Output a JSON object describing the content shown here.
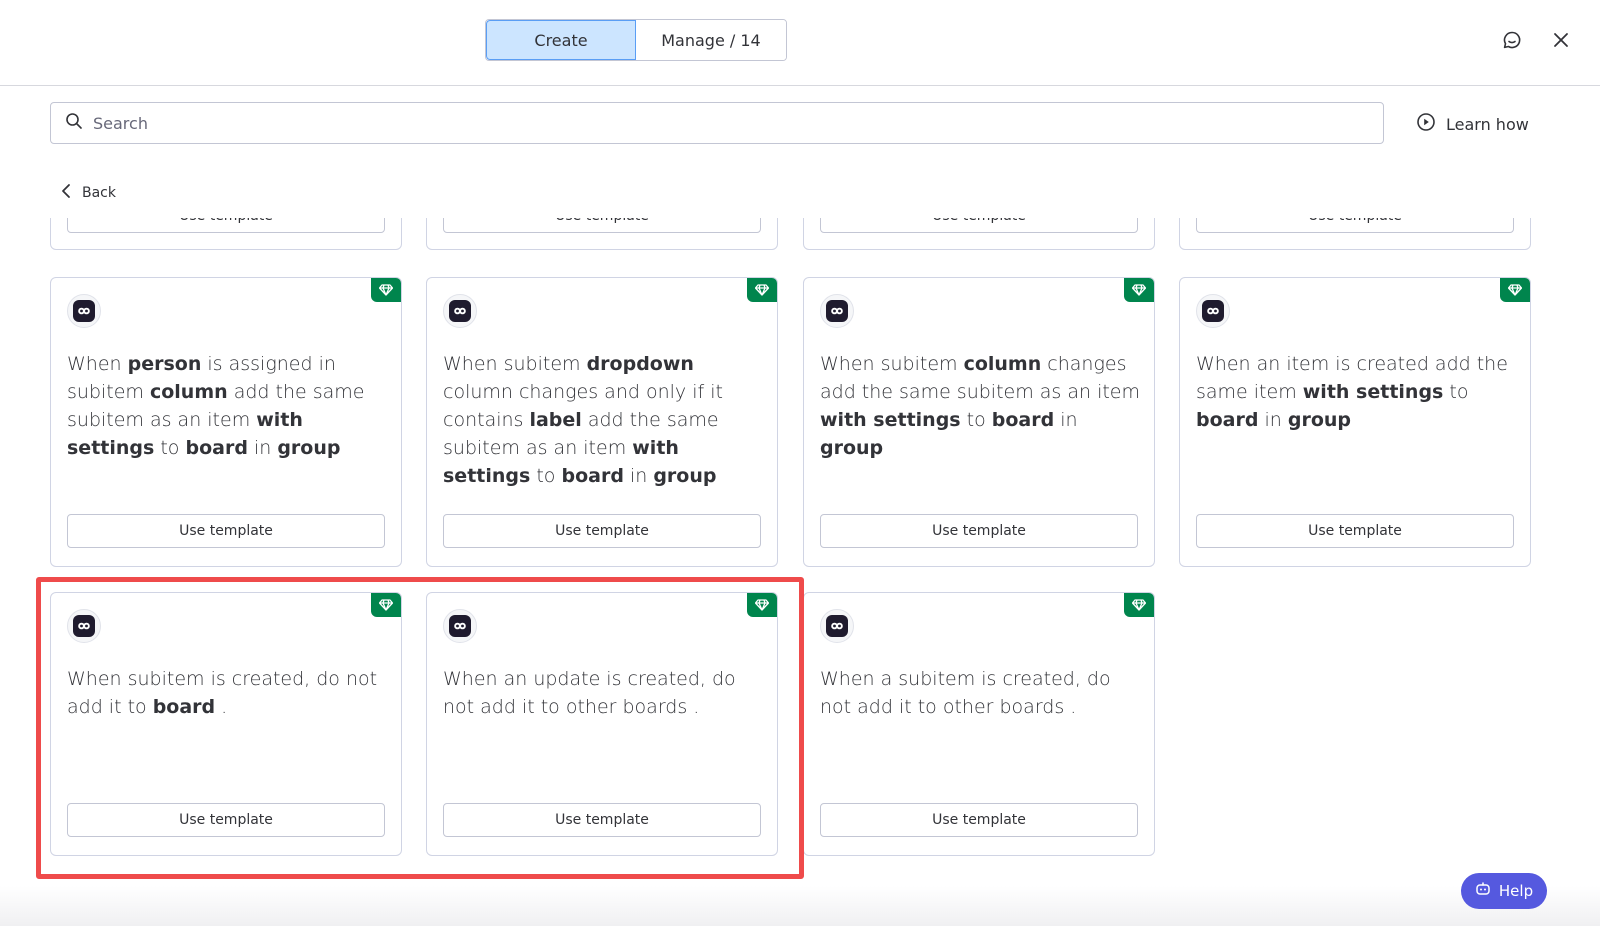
{
  "tabs": {
    "create": "Create",
    "manage": "Manage / 14"
  },
  "search": {
    "placeholder": "Search"
  },
  "learn_how": "Learn how",
  "back": "Back",
  "use_template": "Use template",
  "help": "Help",
  "colors": {
    "accent": "#cce5ff",
    "premium_badge": "#00854d",
    "highlight": "#ef4b4b",
    "help_button": "#5559df"
  },
  "cards": [
    {
      "parts": [
        [
          "When ",
          false
        ],
        [
          "person",
          true
        ],
        [
          " is assigned in subitem ",
          false
        ],
        [
          "column",
          true
        ],
        [
          " add the same subitem as an item ",
          false
        ],
        [
          "with settings",
          true
        ],
        [
          " to ",
          false
        ],
        [
          "board",
          true
        ],
        [
          " in ",
          false
        ],
        [
          "group",
          true
        ]
      ]
    },
    {
      "parts": [
        [
          "When subitem ",
          false
        ],
        [
          "dropdown",
          true
        ],
        [
          " column changes and only if it contains ",
          false
        ],
        [
          "label",
          true
        ],
        [
          " add the same subitem as an item ",
          false
        ],
        [
          "with settings",
          true
        ],
        [
          " to ",
          false
        ],
        [
          "board",
          true
        ],
        [
          " in ",
          false
        ],
        [
          "group",
          true
        ]
      ]
    },
    {
      "parts": [
        [
          "When subitem ",
          false
        ],
        [
          "column",
          true
        ],
        [
          " changes add the same subitem as an item ",
          false
        ],
        [
          "with settings",
          true
        ],
        [
          " to ",
          false
        ],
        [
          "board",
          true
        ],
        [
          " in ",
          false
        ],
        [
          "group",
          true
        ]
      ]
    },
    {
      "parts": [
        [
          "When an item is created add the same item ",
          false
        ],
        [
          "with settings",
          true
        ],
        [
          " to ",
          false
        ],
        [
          "board",
          true
        ],
        [
          " in ",
          false
        ],
        [
          "group",
          true
        ]
      ]
    },
    {
      "parts": [
        [
          "When subitem is created, do not add it to ",
          false
        ],
        [
          "board",
          true
        ],
        [
          " .",
          false
        ]
      ]
    },
    {
      "parts": [
        [
          "When an update is created, do not add it to other boards .",
          false
        ]
      ]
    },
    {
      "parts": [
        [
          "When a subitem is created, do not add it to other boards .",
          false
        ]
      ]
    }
  ]
}
